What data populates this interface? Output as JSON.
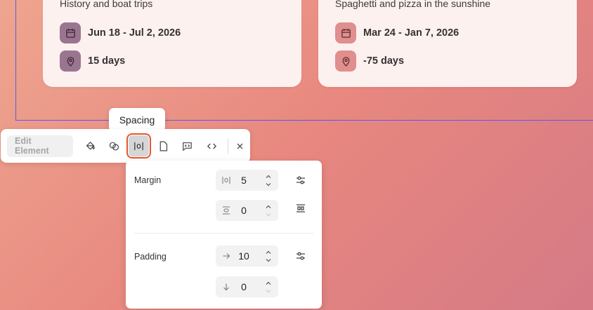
{
  "cards": [
    {
      "subtitle": "History and boat trips",
      "dates": "Jun 18 - Jul 2, 2026",
      "duration": "15 days"
    },
    {
      "subtitle": "Spaghetti and pizza in the sunshine",
      "dates": "Mar 24 - Jan 7, 2026",
      "duration": "-75 days"
    }
  ],
  "toolbar": {
    "edit_label": "Edit Element",
    "tooltip": "Spacing",
    "icons": [
      "paint-bucket-icon",
      "overlap-circles-icon",
      "spacing-icon",
      "page-icon",
      "comment-code-icon",
      "code-icon",
      "close-icon"
    ]
  },
  "spacing_panel": {
    "margin_label": "Margin",
    "margin_horizontal": "5",
    "margin_vertical": "0",
    "padding_label": "Padding",
    "padding_horizontal": "10",
    "padding_vertical": "0"
  },
  "colors": {
    "accent": "#5b5ce2",
    "active_outline": "#e8562b",
    "card_icon_left": "#9a7590",
    "card_icon_right": "#e08e8e"
  }
}
